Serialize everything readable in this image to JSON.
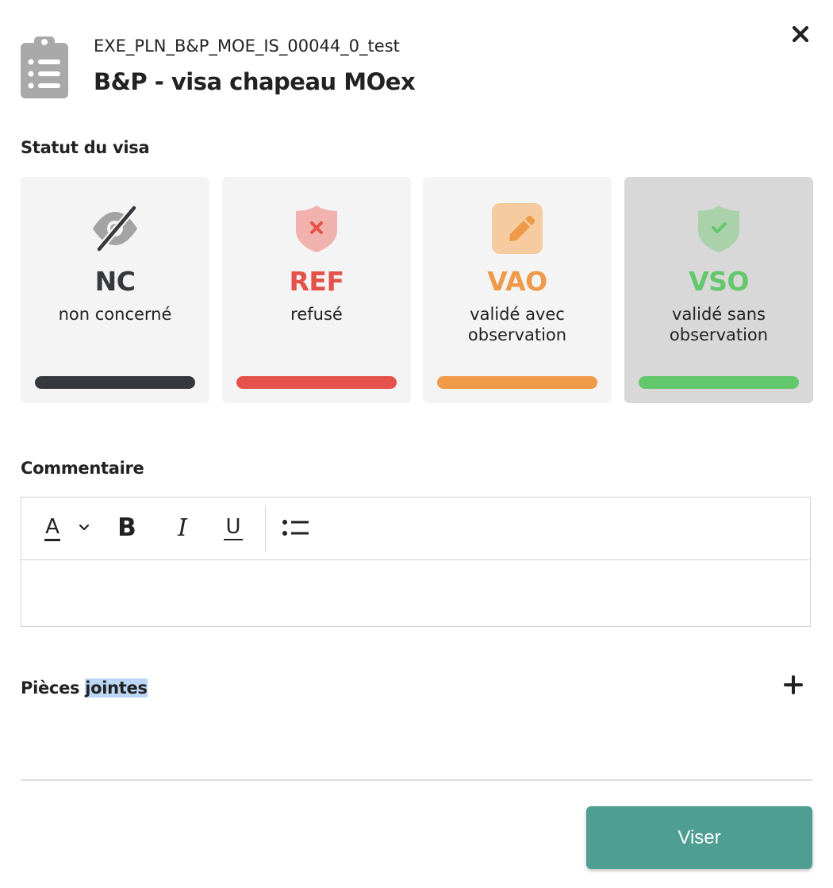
{
  "header": {
    "code": "EXE_PLN_B&P_MOE_IS_00044_0_test",
    "title": "B&P - visa chapeau MOex"
  },
  "status": {
    "heading": "Statut du visa",
    "selected": "VSO",
    "options": [
      {
        "code": "NC",
        "label": "non concerné",
        "color": "#35393d",
        "icon": "eye-slash-icon"
      },
      {
        "code": "REF",
        "label": "refusé",
        "color": "#e5524a",
        "icon": "shield-x-icon"
      },
      {
        "code": "VAO",
        "label": "validé avec observation",
        "color": "#ef9a48",
        "icon": "pencil-icon"
      },
      {
        "code": "VSO",
        "label": "validé sans observation",
        "color": "#63c86c",
        "icon": "shield-check-icon"
      }
    ]
  },
  "comment": {
    "heading": "Commentaire",
    "value": "",
    "toolbar": {
      "color_glyph": "A",
      "bold_glyph": "B",
      "italic_glyph": "I",
      "underline_glyph": "U"
    }
  },
  "attachments": {
    "heading_part1": "Pièces ",
    "heading_part2": "jointes"
  },
  "footer": {
    "submit_label": "Viser"
  }
}
